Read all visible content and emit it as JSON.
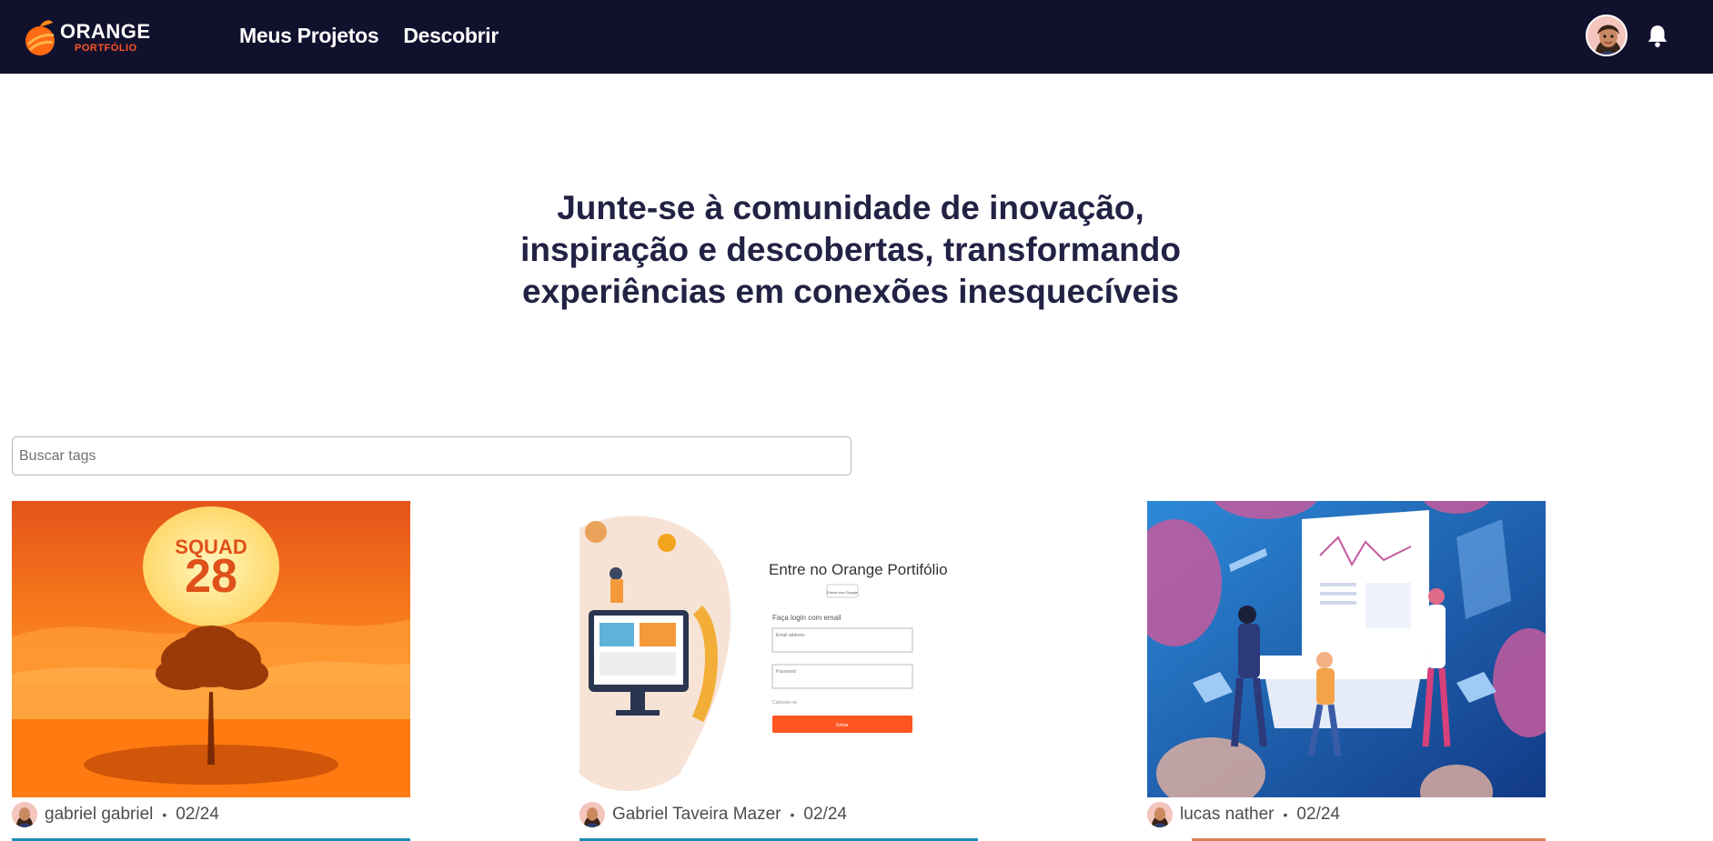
{
  "header": {
    "logo": {
      "main": "ORANGE",
      "sub": "PORTFÓLIO"
    },
    "nav": [
      {
        "label": "Meus Projetos"
      },
      {
        "label": "Descobrir"
      }
    ],
    "icons": {
      "avatar": "user-avatar",
      "notifications": "bell-icon"
    }
  },
  "hero": {
    "line1": "Junte-se à comunidade de inovação,",
    "line2": "inspiração e descobertas, transformando",
    "line3": "experiências em conexões inesquecíveis"
  },
  "search": {
    "placeholder": "Buscar tags",
    "value": ""
  },
  "projects": [
    {
      "author": "gabriel gabriel",
      "date": "02/24",
      "image": {
        "title_top": "SQUAD",
        "title_num": "28"
      }
    },
    {
      "author": "Gabriel Taveira Mazer",
      "date": "02/24",
      "image": {
        "heading": "Entre no Orange Portifólio",
        "google_btn": "Entrar com Google",
        "subheading": "Faça login com email",
        "email_label": "Email address",
        "password_label": "Password",
        "signup_link": "Cadastre-se",
        "submit_label": "Entrar"
      }
    },
    {
      "author": "lucas nather",
      "date": "02/24",
      "image": {}
    }
  ],
  "colors": {
    "header_bg": "#11112e",
    "accent_orange": "#ff5522",
    "text_dark": "#222244",
    "card_bar": "#1a8fb8"
  }
}
